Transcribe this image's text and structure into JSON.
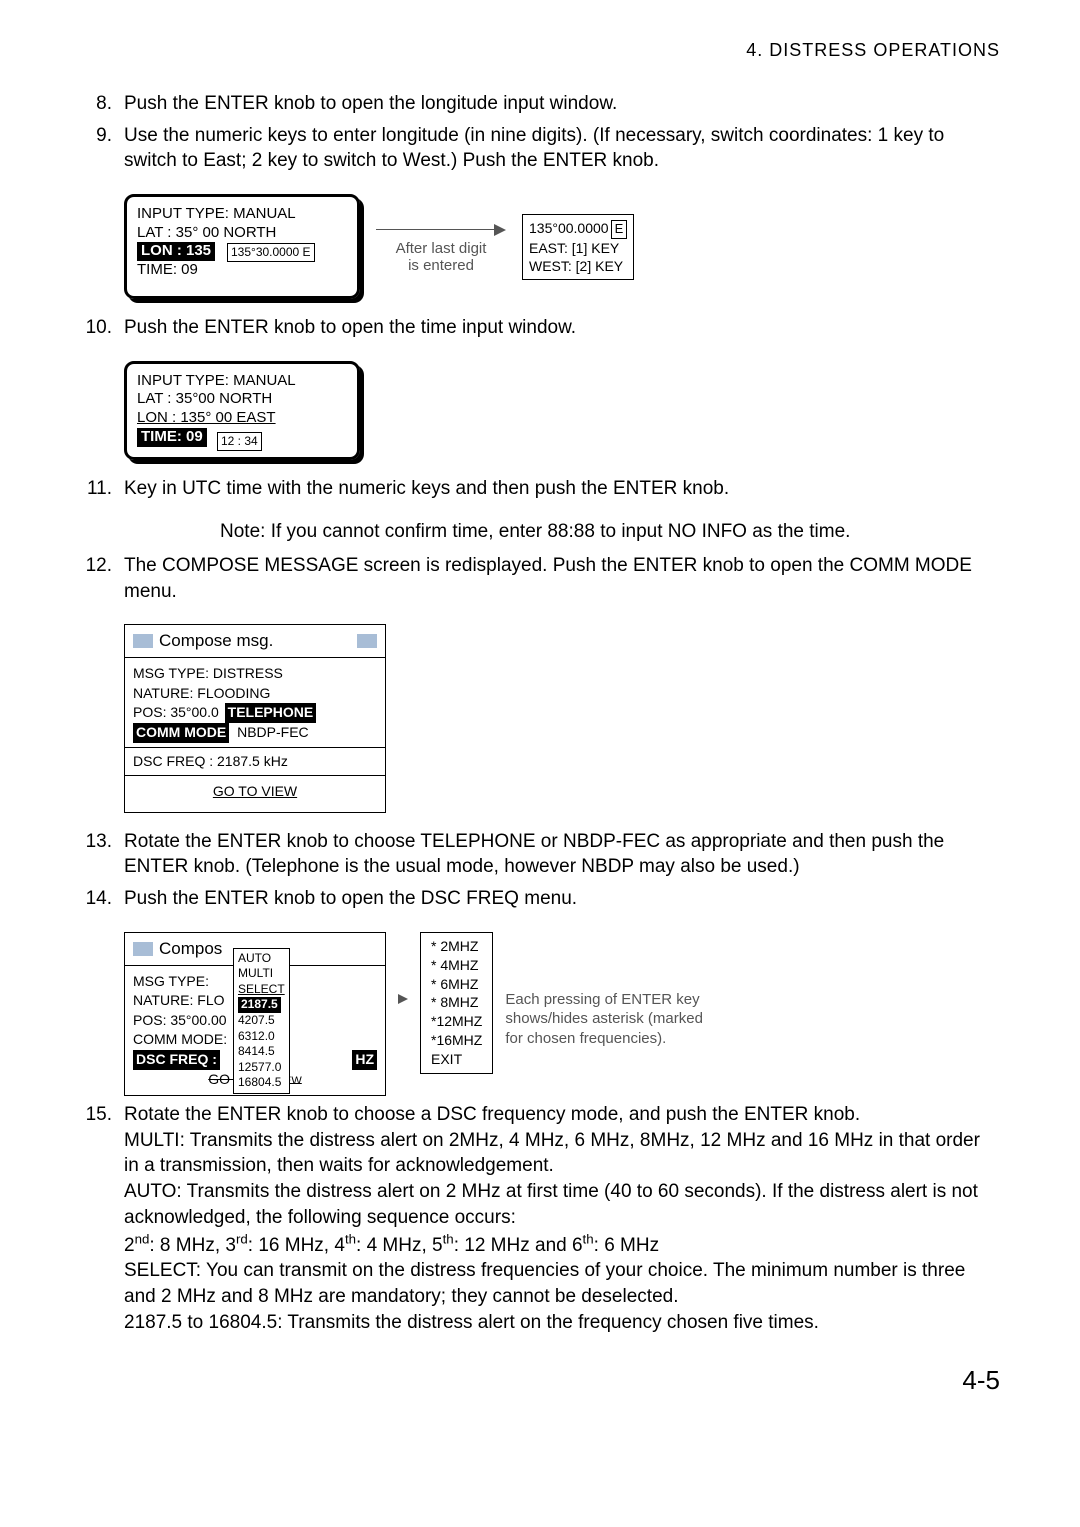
{
  "header": "4.  DISTRESS  OPERATIONS",
  "steps": {
    "s8": "Push the ENTER knob to open the longitude input window.",
    "s9": "Use the numeric keys to enter longitude (in nine digits). (If necessary, switch coordinates: 1 key to switch to East; 2 key to switch to West.) Push the ENTER knob.",
    "s10": "Push the ENTER knob to open the time input window.",
    "s11": "Key in UTC time with the numeric keys and then push the ENTER knob.",
    "s11_note": "Note: If you cannot confirm time, enter 88:88 to input NO INFO as the time.",
    "s12": "The COMPOSE MESSAGE screen is redisplayed. Push the ENTER knob to open the COMM MODE menu.",
    "s13": "Rotate the ENTER knob to choose TELEPHONE or NBDP-FEC as appropriate and then push the ENTER knob. (Telephone is the usual mode, however NBDP may also be used.)",
    "s14": "Push the ENTER knob to open the DSC FREQ menu.",
    "s15a": "Rotate the ENTER knob to choose a DSC frequency mode, and push the ENTER knob.",
    "s15b": "MULTI: Transmits the distress alert on 2MHz, 4 MHz, 6 MHz, 8MHz, 12 MHz and 16 MHz in that order in a transmission, then waits for acknowledgement.",
    "s15c": "AUTO: Transmits the distress alert on 2 MHz at first time (40 to 60 seconds). If the distress alert is not acknowledged, the following sequence occurs:",
    "s15e": "SELECT: You can transmit on the distress frequencies of your choice. The minimum number is three and 2 MHz and 8 MHz are mandatory; they cannot be deselected.",
    "s15f": "2187.5 to 16804.5: Transmits the distress alert on the frequency chosen five times."
  },
  "seq": {
    "p1a": "2",
    "p1b": ": 8 MHz, 3",
    "p2b": ": 16 MHz, 4",
    "p3b": ": 4 MHz, 5",
    "p4b": ": 12 MHz and 6",
    "p5b": ": 6 MHz",
    "o1": "nd",
    "o2": "rd",
    "o3": "th",
    "o4": "th",
    "o5": "th"
  },
  "lcd1": {
    "l1": "INPUT  TYPE: MANUAL",
    "l2": "LAT  :   35° 00 NORTH",
    "l3_hl": "LON : 135",
    "popup": "135°30.0000 E",
    "l4": "TIME:   09"
  },
  "arrow1": {
    "a": "After last digit",
    "b": "is entered"
  },
  "eastbox": {
    "top": "135°00.0000",
    "e": "E",
    "k1": "EAST: [1] KEY",
    "k2": "WEST: [2] KEY"
  },
  "lcd2": {
    "l1": "INPUT  TYPE: MANUAL",
    "l2": "LAT :   35°00 NORTH",
    "l3": "LON : 135° 00 EAST",
    "l4_hl": "TIME:   09",
    "popup": "12 : 34"
  },
  "compose1": {
    "title": "Compose msg.",
    "l1": "MSG TYPE:    DISTRESS",
    "l2": "NATURE: FLOODING",
    "l3": "POS: 35°00.0",
    "pop_tel": "TELEPHONE",
    "l4_hl": "COMM MODE",
    "l4_rest": "NBDP-FEC",
    "l5": "DSC FREQ :  2187.5 kHz",
    "link": "GO TO VIEW"
  },
  "compose2": {
    "title": "Compos",
    "l1": "MSG TYPE:",
    "l2": "NATURE: FLO",
    "l3": "POS: 35°00.00",
    "l4": "COMM MODE:",
    "l5_hl": "DSC FREQ :",
    "l5_suffix": "HZ",
    "go": "GO",
    "menu": {
      "m1": "AUTO",
      "m2": "MULTI",
      "m3": "SELECT",
      "m4_hl": "2187.5",
      "m5": "4207.5",
      "m6": "6312.0",
      "m7": "8414.5",
      "m8": "12577.0",
      "m9": "16804.5",
      "tail": "TO ALL VIEW"
    }
  },
  "freqbox": {
    "f1": "*  2MHZ",
    "f2": "*  4MHZ",
    "f3": "*  6MHZ",
    "f4": "*  8MHZ",
    "f5": "*12MHZ",
    "f6": "*16MHZ",
    "f7": "  EXIT"
  },
  "freq_note": {
    "n1": "Each pressing of ENTER key",
    "n2": "shows/hides asterisk (marked",
    "n3": "for chosen frequencies)."
  },
  "pagenum": "4-5"
}
